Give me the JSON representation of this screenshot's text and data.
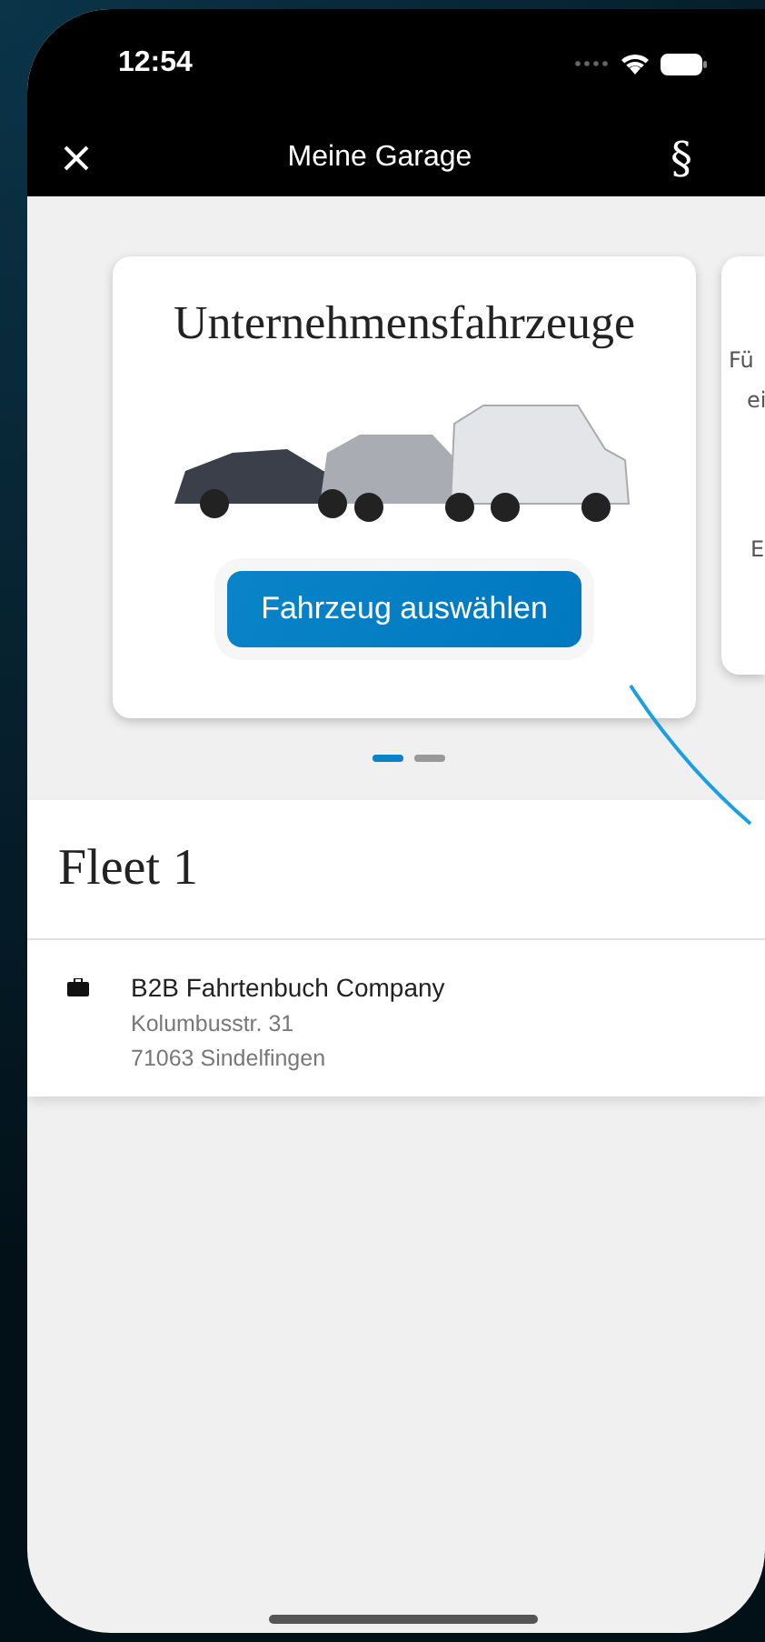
{
  "status_bar": {
    "time": "12:54"
  },
  "nav": {
    "title": "Meine Garage",
    "right_symbol": "§"
  },
  "cards": [
    {
      "kind": "fleet",
      "title": "Unternehmensfahrzeuge",
      "button": "Fahrzeug auswählen"
    },
    {
      "kind": "peek",
      "lines": [
        "Fü",
        "ei",
        "E"
      ]
    }
  ],
  "pager": [
    {
      "selected": true
    },
    {
      "selected": false
    }
  ],
  "fleet": {
    "title": "Fleet 1",
    "company": {
      "name": "B2B Fahrtenbuch Company",
      "street": "Kolumbusstr. 31",
      "city": "71063 Sindelfingen"
    }
  }
}
